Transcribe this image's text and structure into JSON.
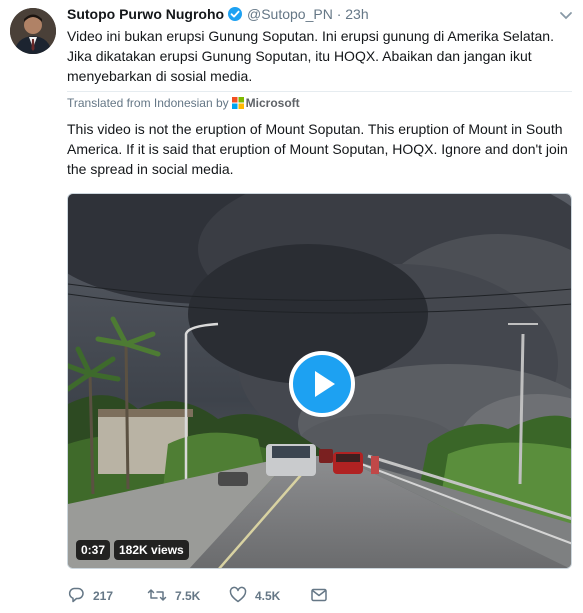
{
  "tweet": {
    "name": "Sutopo Purwo Nugroho",
    "handle": "@Sutopo_PN",
    "separator": "·",
    "time": "23h",
    "text": "Video ini bukan erupsi Gunung Soputan. Ini erupsi gunung di Amerika Selatan. Jika dikatakan erupsi Gunung Soputan, itu HOQX. Abaikan dan jangan ikut menyebarkan di sosial media.",
    "translated_label": "Translated from Indonesian by",
    "translator": "Microsoft",
    "translation": "This video is not the eruption of Mount Soputan. This eruption of Mount in South America. If it is said that eruption of Mount Soputan, HOQX. Ignore and don't join the spread in social media."
  },
  "media": {
    "duration": "0:37",
    "views": "182K views"
  },
  "actions": {
    "replies": "217",
    "retweets": "7.5K",
    "likes": "4.5K"
  },
  "colors": {
    "accent": "#1da1f2",
    "muted": "#657786",
    "text": "#14171a"
  },
  "icons": [
    "verified-icon",
    "chevron-down-icon",
    "microsoft-logo",
    "play-icon",
    "reply-icon",
    "retweet-icon",
    "like-icon",
    "direct-message-icon"
  ]
}
